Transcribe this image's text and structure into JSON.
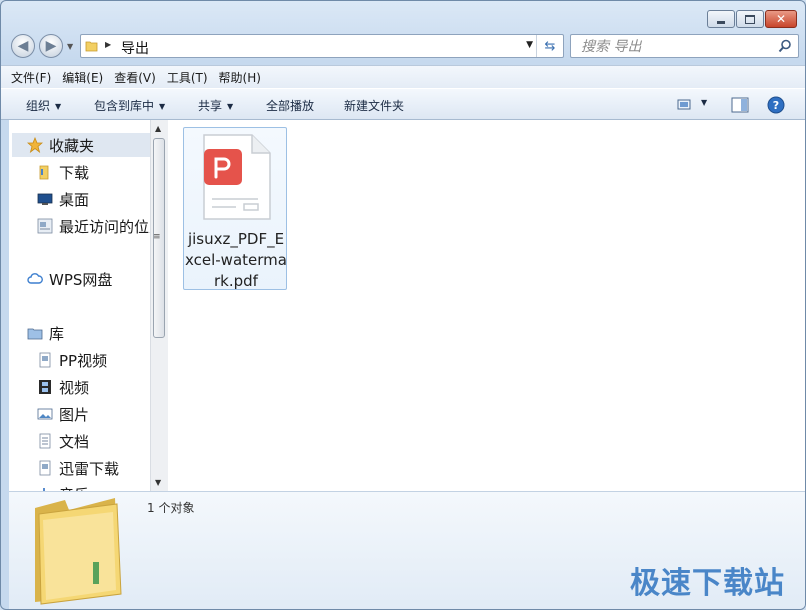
{
  "window": {
    "caption": {
      "minimize_icon": "minimize-icon",
      "maximize_icon": "maximize-icon",
      "close_icon": "close-icon"
    }
  },
  "address_bar": {
    "path": "导出",
    "back_icon": "back-arrow-icon",
    "forward_icon": "forward-arrow-icon",
    "refresh_icon": "refresh-icon"
  },
  "search": {
    "placeholder": "搜索 导出",
    "icon": "search-icon"
  },
  "menu": {
    "file": "文件(F)",
    "edit": "编辑(E)",
    "view": "查看(V)",
    "tools": "工具(T)",
    "help": "帮助(H)"
  },
  "toolbar": {
    "organize": "组织",
    "include_in_library": "包含到库中",
    "share": "共享",
    "play_all": "全部播放",
    "new_folder": "新建文件夹"
  },
  "nav": {
    "favorites": "收藏夹",
    "downloads": "下载",
    "desktop": "桌面",
    "recent": "最近访问的位置",
    "wps_cloud": "WPS网盘",
    "libraries": "库",
    "pp_video": "PP视频",
    "videos": "视频",
    "pictures": "图片",
    "documents": "文档",
    "xunlei": "迅雷下载",
    "music": "音乐"
  },
  "files": [
    {
      "name": "jisuxz_PDF_Excel-watermark.pdf",
      "icon": "pdf-file-icon"
    }
  ],
  "details": {
    "count": "1 个对象"
  },
  "watermark": "极速下载站",
  "colors": {
    "accent": "#4a86c8",
    "pdf_red": "#e5534b",
    "folder_yellow": "#f2cf63"
  }
}
